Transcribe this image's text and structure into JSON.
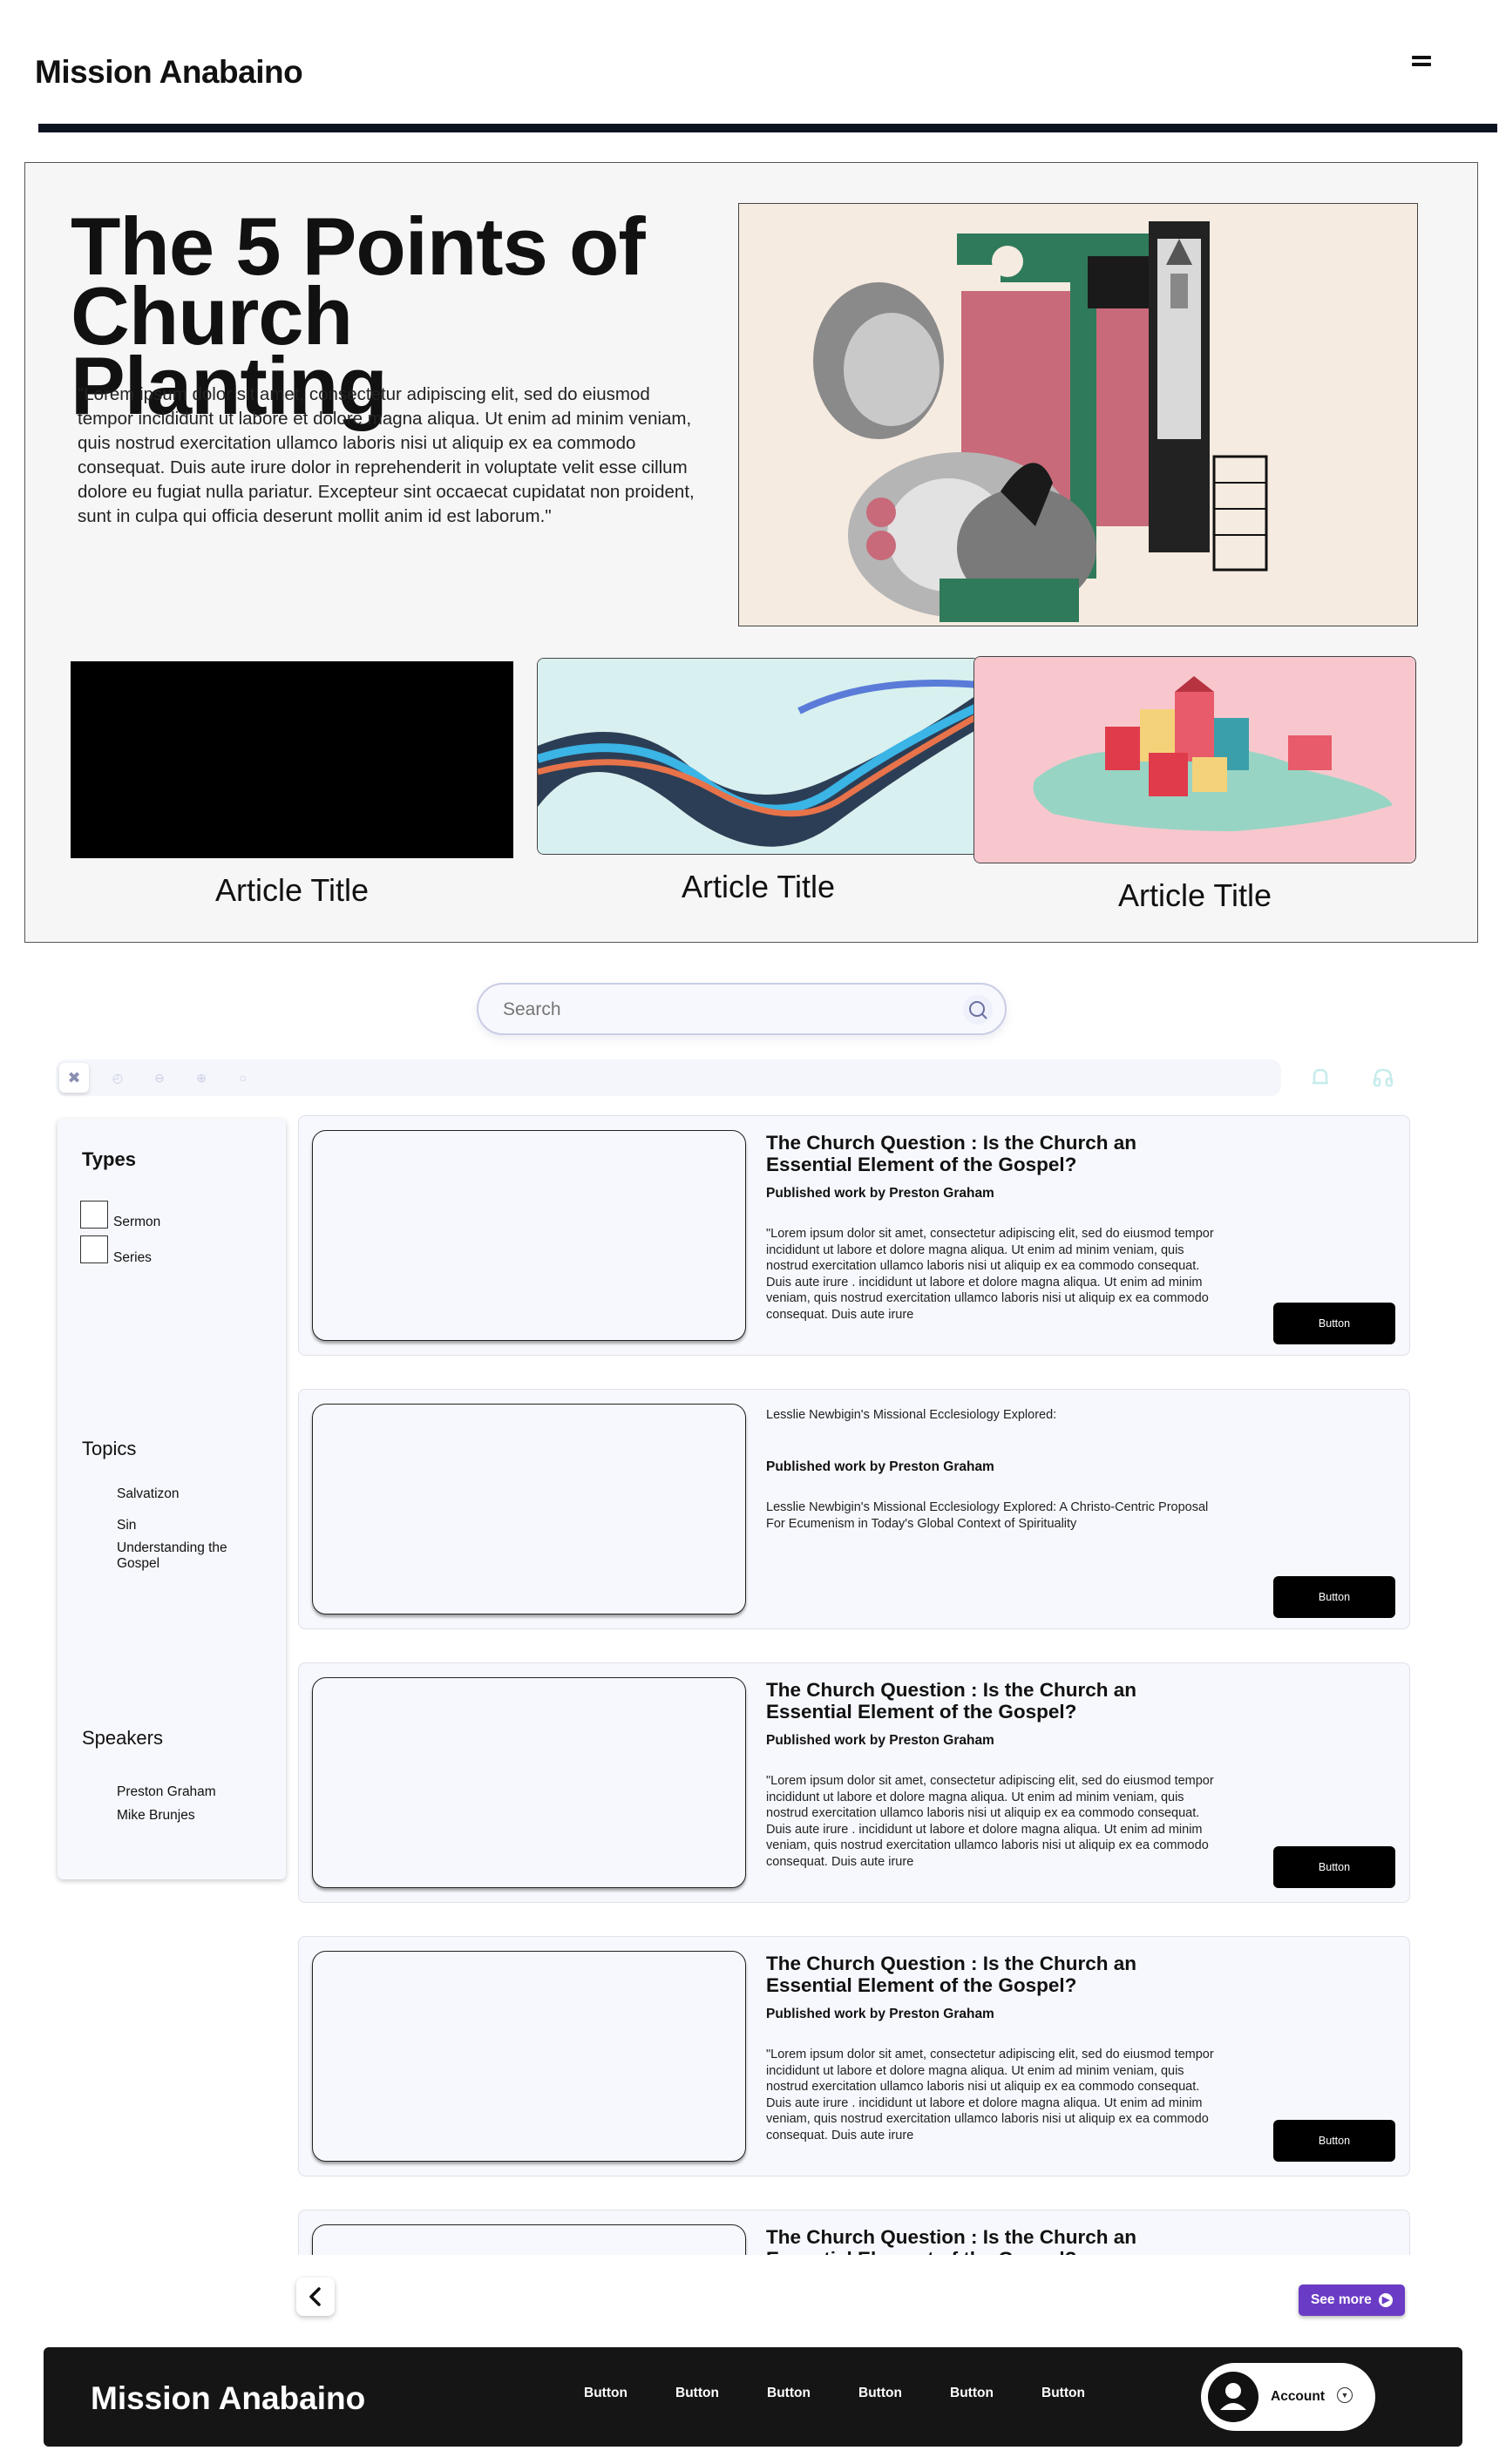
{
  "header": {
    "brand": "Mission Anabaino"
  },
  "hero": {
    "title": "The 5 Points of Church Planting",
    "text": "\"Lorem ipsum dolor sit amet, consectetur adipiscing elit, sed do eiusmod tempor incididunt ut labore et dolore magna aliqua. Ut enim ad minim veniam, quis nostrud exercitation ullamco laboris nisi ut aliquip ex ea commodo consequat. Duis aute irure dolor in reprehenderit in voluptate velit esse cillum dolore eu fugiat nulla pariatur. Excepteur sint occaecat cupidatat non proident, sunt in culpa qui officia deserunt mollit anim id est laborum.\""
  },
  "articles": [
    {
      "title": "Article Title"
    },
    {
      "title": "Article Title"
    },
    {
      "title": "Article Title"
    }
  ],
  "search": {
    "placeholder": "Search"
  },
  "sidebar": {
    "types_heading": "Types",
    "types": [
      "Sermon",
      "Series"
    ],
    "topics_heading": "Topics",
    "topics": [
      "Salvatizon",
      "Sin",
      "Understanding the Gospel"
    ],
    "speakers_heading": "Speakers",
    "speakers": [
      "Preston Graham",
      "Mike Brunjes"
    ]
  },
  "feed": [
    {
      "title": "The Church Question : Is the Church an Essential Element of the Gospel?",
      "author": "Published work by Preston Graham",
      "desc": "\"Lorem ipsum dolor sit amet, consectetur adipiscing elit, sed do eiusmod tempor incididunt ut labore et dolore magna aliqua. Ut enim ad minim veniam, quis nostrud exercitation ullamco laboris nisi ut aliquip ex ea commodo consequat. Duis aute irure .  incididunt ut labore et dolore magna aliqua. Ut enim ad minim veniam, quis nostrud exercitation ullamco laboris nisi ut aliquip ex ea commodo consequat. Duis aute irure",
      "button": "Button"
    },
    {
      "title": "Lesslie Newbigin's Missional Ecclesiology Explored:",
      "author": "Published work by Preston Graham",
      "desc": "Lesslie Newbigin's Missional Ecclesiology Explored: A Christo-Centric Proposal For Ecumenism in Today's Global Context of Spirituality",
      "button": "Button"
    },
    {
      "title": "The Church Question : Is the Church an Essential Element of the Gospel?",
      "author": "Published work by Preston Graham",
      "desc": "\"Lorem ipsum dolor sit amet, consectetur adipiscing elit, sed do eiusmod tempor incididunt ut labore et dolore magna aliqua. Ut enim ad minim veniam, quis nostrud exercitation ullamco laboris nisi ut aliquip ex ea commodo consequat. Duis aute irure .  incididunt ut labore et dolore magna aliqua. Ut enim ad minim veniam, quis nostrud exercitation ullamco laboris nisi ut aliquip ex ea commodo consequat. Duis aute irure",
      "button": "Button"
    },
    {
      "title": "The Church Question : Is the Church an Essential Element of the Gospel?",
      "author": "Published work by Preston Graham",
      "desc": "\"Lorem ipsum dolor sit amet, consectetur adipiscing elit, sed do eiusmod tempor incididunt ut labore et dolore magna aliqua. Ut enim ad minim veniam, quis nostrud exercitation ullamco laboris nisi ut aliquip ex ea commodo consequat. Duis aute irure .  incididunt ut labore et dolore magna aliqua. Ut enim ad minim veniam, quis nostrud exercitation ullamco laboris nisi ut aliquip ex ea commodo consequat. Duis aute irure",
      "button": "Button"
    },
    {
      "title": "The Church Question : Is the Church an Essential Element of the Gospel?"
    }
  ],
  "pagination": {
    "see_more": "See more"
  },
  "footer": {
    "brand": "Mission Anabaino",
    "buttons": [
      "Button",
      "Button",
      "Button",
      "Button",
      "Button",
      "Button"
    ],
    "account": "Account"
  },
  "colors": {
    "accent": "#6a3cc5",
    "footer_bg": "#151515",
    "header_rule": "#0d1221"
  }
}
